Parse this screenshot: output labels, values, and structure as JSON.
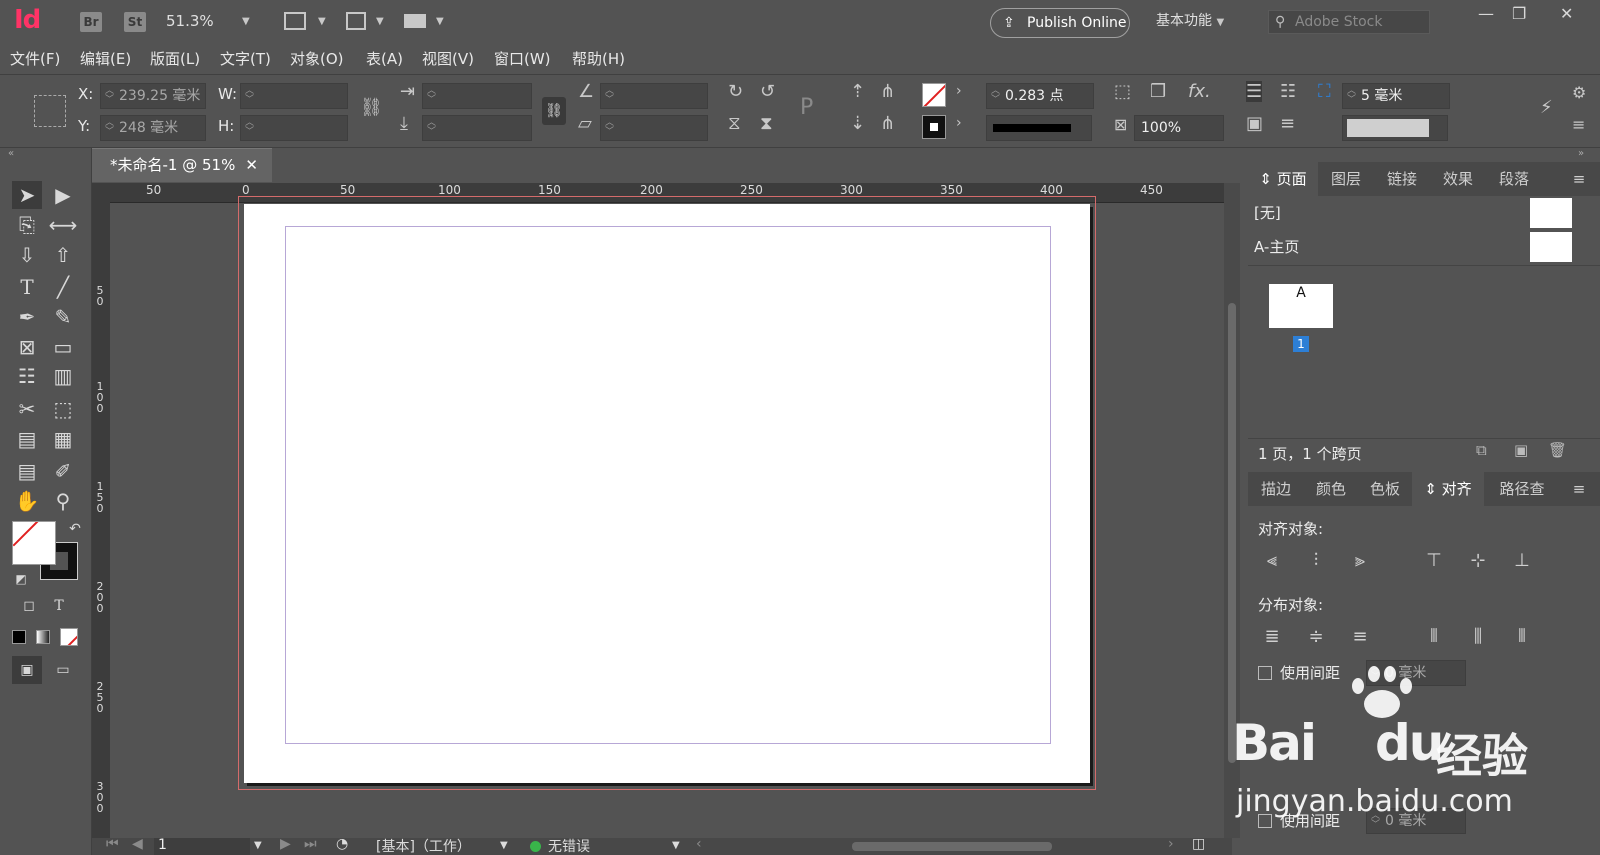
{
  "app": {
    "logo": "Id",
    "bridge": "Br",
    "stock_btn": "St",
    "zoom": "51.3%",
    "publish": "Publish Online",
    "workspace": "基本功能",
    "search_placeholder": "Adobe Stock",
    "window_controls": [
      "—",
      "❐",
      "✕"
    ]
  },
  "menu": [
    "文件(F)",
    "编辑(E)",
    "版面(L)",
    "文字(T)",
    "对象(O)",
    "表(A)",
    "视图(V)",
    "窗口(W)",
    "帮助(H)"
  ],
  "control": {
    "x_label": "X:",
    "x_value": "239.25 毫米",
    "y_label": "Y:",
    "y_value": "248 毫米",
    "w_label": "W:",
    "h_label": "H:",
    "stroke_weight": "0.283 点",
    "opacity": "100%",
    "offset": "5 毫米",
    "fx": "fx."
  },
  "doc_tab": {
    "title": "*未命名-1 @ 51%",
    "close": "✕"
  },
  "ruler_h": [
    "50",
    "0",
    "50",
    "100",
    "150",
    "200",
    "250",
    "300",
    "350",
    "400",
    "450"
  ],
  "ruler_v": [
    "5\n0",
    "1\n0\n0",
    "1\n5\n0",
    "2\n0\n0",
    "2\n5\n0",
    "3\n0\n0"
  ],
  "pages_panel": {
    "tabs": [
      "页面",
      "图层",
      "链接",
      "效果",
      "段落"
    ],
    "none": "[无]",
    "master": "A-主页",
    "page_letter": "A",
    "page_number": "1",
    "footer": "1 页，1 个跨页"
  },
  "align_panel": {
    "tabs": [
      "描边",
      "颜色",
      "色板",
      "对齐",
      "路径查"
    ],
    "align_objects": "对齐对象:",
    "distribute_objects": "分布对象:",
    "use_spacing": "使用间距",
    "spacing_value": "0 毫米",
    "use_spacing2": "使用间距",
    "spacing_value2": "0 毫米"
  },
  "status": {
    "page": "1",
    "preflight_profile": "[基本]（工作）",
    "errors": "无错误"
  },
  "watermark": {
    "brand": "Bai",
    "brand2": "du",
    "cn": "经验",
    "url": "jingyan.baidu.com"
  },
  "colors": {
    "accent": "#2d7fd6",
    "logo": "#ff3366",
    "ok": "#39b54a"
  }
}
